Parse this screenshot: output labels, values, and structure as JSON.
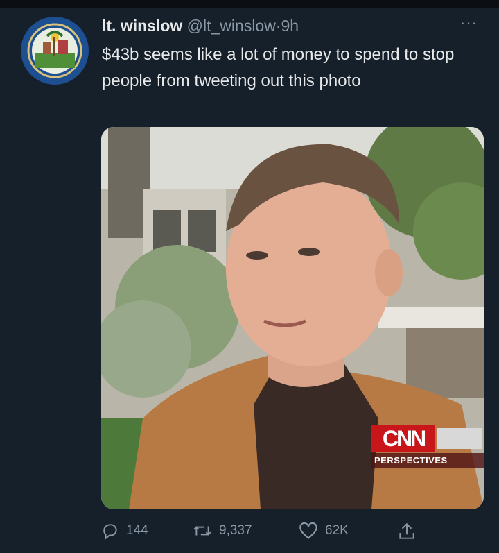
{
  "tweet": {
    "display_name": "lt. winslow",
    "handle": "@lt_winslow",
    "separator": "·",
    "time": "9h",
    "more_label": "···",
    "text": "$43b seems like a lot of money to spend to stop people from tweeting out this photo",
    "avatar_icon": "city-seal-icon"
  },
  "media": {
    "watermark_logo": "CNN",
    "watermark_subtitle": "PERSPECTIVES"
  },
  "actions": {
    "replies": "144",
    "retweets": "9,337",
    "likes": "62K"
  },
  "colors": {
    "background": "#15202b",
    "text": "#e7e9ea",
    "secondary": "#8b98a5",
    "cnn_red": "#c8161b"
  }
}
